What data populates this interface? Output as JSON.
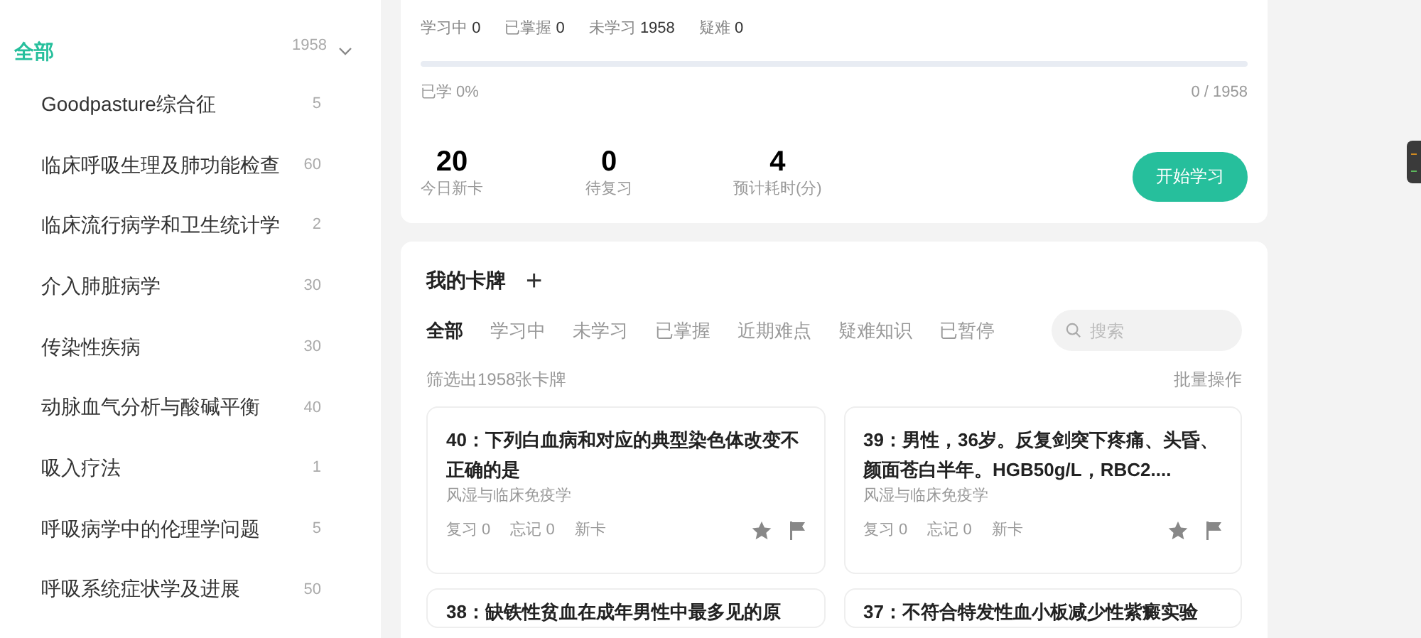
{
  "sidebar": {
    "all": {
      "label": "全部",
      "count": "1958",
      "selected": true,
      "expanded": true
    },
    "items": [
      {
        "label": "Goodpasture综合征",
        "count": "5",
        "selected": false
      },
      {
        "label": "临床呼吸生理及肺功能检查",
        "count": "60",
        "selected": false
      },
      {
        "label": "临床流行病学和卫生统计学",
        "count": "2",
        "selected": false
      },
      {
        "label": "介入肺脏病学",
        "count": "30",
        "selected": false
      },
      {
        "label": "传染性疾病",
        "count": "30",
        "selected": false
      },
      {
        "label": "动脉血气分析与酸碱平衡",
        "count": "40",
        "selected": false
      },
      {
        "label": "吸入疗法",
        "count": "1",
        "selected": false
      },
      {
        "label": "呼吸病学中的伦理学问题",
        "count": "5",
        "selected": false
      },
      {
        "label": "呼吸系统症状学及进展",
        "count": "50",
        "selected": false
      }
    ]
  },
  "overview": {
    "status_counts": [
      {
        "label": "学习中",
        "value": "0"
      },
      {
        "label": "已掌握",
        "value": "0"
      },
      {
        "label": "未学习",
        "value": "1958"
      },
      {
        "label": "疑难",
        "value": "0"
      }
    ],
    "progress": {
      "level": 0,
      "label": "已学 0%",
      "reading": "0 / 1958"
    },
    "stats": [
      {
        "value": "20",
        "label": "今日新卡"
      },
      {
        "value": "0",
        "label": "待复习"
      },
      {
        "value": "4",
        "label": "预计耗时(分)"
      }
    ],
    "start_button": "开始学习"
  },
  "cards_panel": {
    "title": "我的卡牌",
    "add_icon": "+",
    "tabs": [
      {
        "label": "全部",
        "selected": true
      },
      {
        "label": "学习中",
        "selected": false
      },
      {
        "label": "未学习",
        "selected": false
      },
      {
        "label": "已掌握",
        "selected": false
      },
      {
        "label": "近期难点",
        "selected": false
      },
      {
        "label": "疑难知识",
        "selected": false
      },
      {
        "label": "已暂停",
        "selected": false
      }
    ],
    "search": {
      "placeholder": "搜索"
    },
    "filter_summary": "筛选出1958张卡牌",
    "batch_action": "批量操作",
    "cards": [
      {
        "title": "40：下列白血病和对应的典型染色体改变不正确的是",
        "subject": "风湿与临床免疫学",
        "review": "复习 0",
        "forgot": "忘记 0",
        "status": "新卡"
      },
      {
        "title": "39：男性，36岁。反复剑突下疼痛、头昏、颜面苍白半年。HGB50g/L，RBC2....",
        "subject": "风湿与临床免疫学",
        "review": "复习 0",
        "forgot": "忘记 0",
        "status": "新卡"
      },
      {
        "title": "38：缺铁性贫血在成年男性中最多见的原"
      },
      {
        "title": "37：不符合特发性血小板减少性紫癜实验"
      }
    ]
  }
}
